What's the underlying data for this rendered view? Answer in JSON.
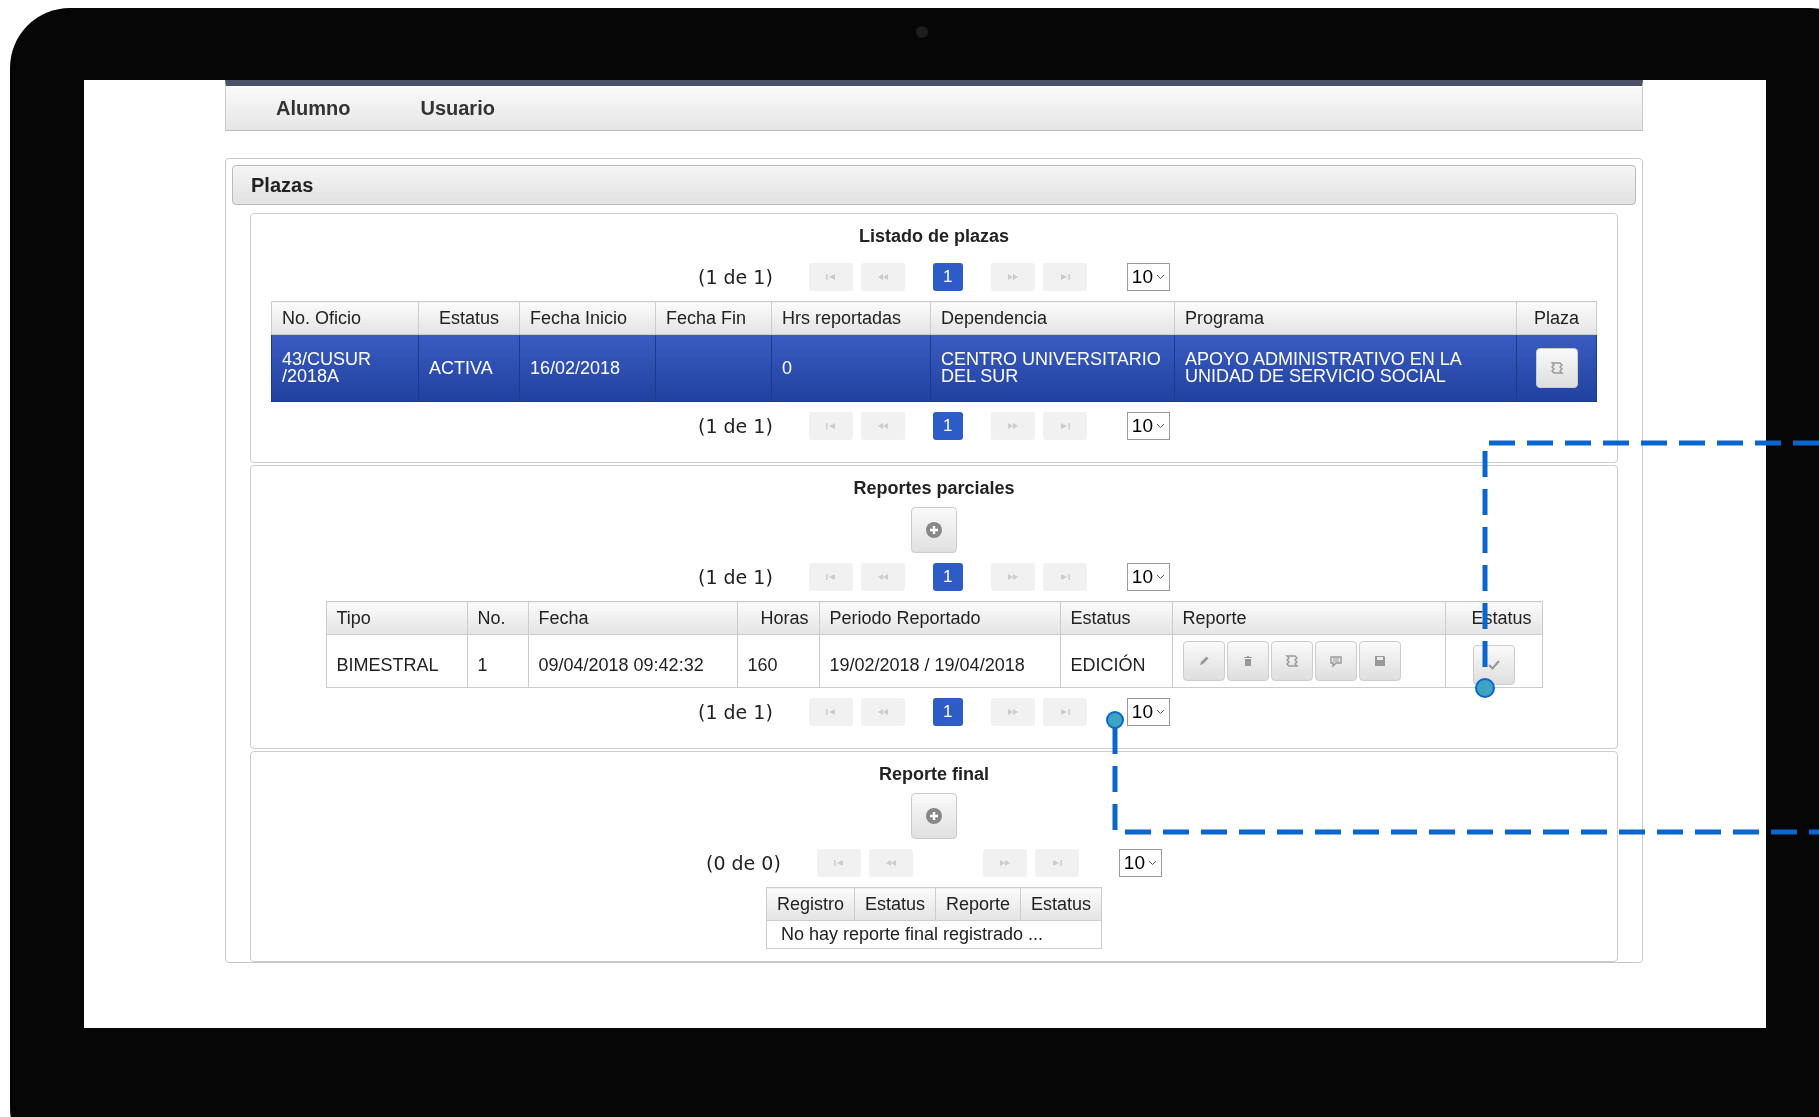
{
  "nav": [
    {
      "label": "Alumno"
    },
    {
      "label": "Usuario"
    }
  ],
  "panel": {
    "title": "Plazas"
  },
  "sections": [
    {
      "title": "Listado de plazas",
      "pager_top": {
        "summary": "(1 de 1)",
        "pages": [
          {
            "label": "1",
            "selected": true
          }
        ],
        "page_size": "10"
      },
      "table": {
        "columns": [
          "No. Oficio",
          "Estatus",
          "Fecha Inicio",
          "Fecha Fin",
          "Hrs reportadas",
          "Dependencia",
          "Programa",
          "Plaza"
        ],
        "rows": [
          {
            "selected": true,
            "cells": [
              {
                "kind": "text",
                "text": "43/CUSUR /2018A"
              },
              {
                "kind": "text",
                "text": "ACTIVA"
              },
              {
                "kind": "text",
                "text": "16/02/2018"
              },
              {
                "kind": "text",
                "text": ""
              },
              {
                "kind": "text",
                "text": "0"
              },
              {
                "kind": "text",
                "text": "CENTRO UNIVERSITARIO DEL SUR"
              },
              {
                "kind": "text",
                "text": "APOYO ADMINISTRATIVO EN LA UNIDAD DE SERVICIO SOCIAL"
              },
              {
                "kind": "plaza-action"
              }
            ]
          }
        ]
      },
      "pager_bottom": {
        "summary": "(1 de 1)",
        "pages": [
          {
            "label": "1",
            "selected": true
          }
        ],
        "page_size": "10"
      }
    },
    {
      "title": "Reportes parciales",
      "add_button": true,
      "pager_top": {
        "summary": "(1 de 1)",
        "pages": [
          {
            "label": "1",
            "selected": true
          }
        ],
        "page_size": "10"
      },
      "table": {
        "columns": [
          "Tipo",
          "No.",
          "Fecha",
          "Horas",
          "Periodo Reportado",
          "Estatus",
          "Reporte",
          "Estatus"
        ],
        "rows": [
          {
            "selected": false,
            "cells": [
              {
                "kind": "text",
                "text": "BIMESTRAL"
              },
              {
                "kind": "text",
                "text": "1"
              },
              {
                "kind": "text",
                "text": "09/04/2018 09:42:32"
              },
              {
                "kind": "text",
                "text": "160"
              },
              {
                "kind": "text",
                "text": "19/02/2018 / 19/04/2018"
              },
              {
                "kind": "text",
                "text": "EDICIÓN"
              },
              {
                "kind": "report-actions"
              },
              {
                "kind": "status-action"
              }
            ]
          }
        ]
      },
      "pager_bottom": {
        "summary": "(1 de 1)",
        "pages": [
          {
            "label": "1",
            "selected": true
          }
        ],
        "page_size": "10"
      }
    },
    {
      "title": "Reporte final",
      "add_button": true,
      "pager_top": {
        "summary": "(0 de 0)",
        "page_size": "10"
      },
      "table": {
        "columns": [
          "Registro",
          "Estatus",
          "Reporte",
          "Estatus"
        ],
        "empty_message": "No hay reporte final registrado ..."
      }
    }
  ]
}
